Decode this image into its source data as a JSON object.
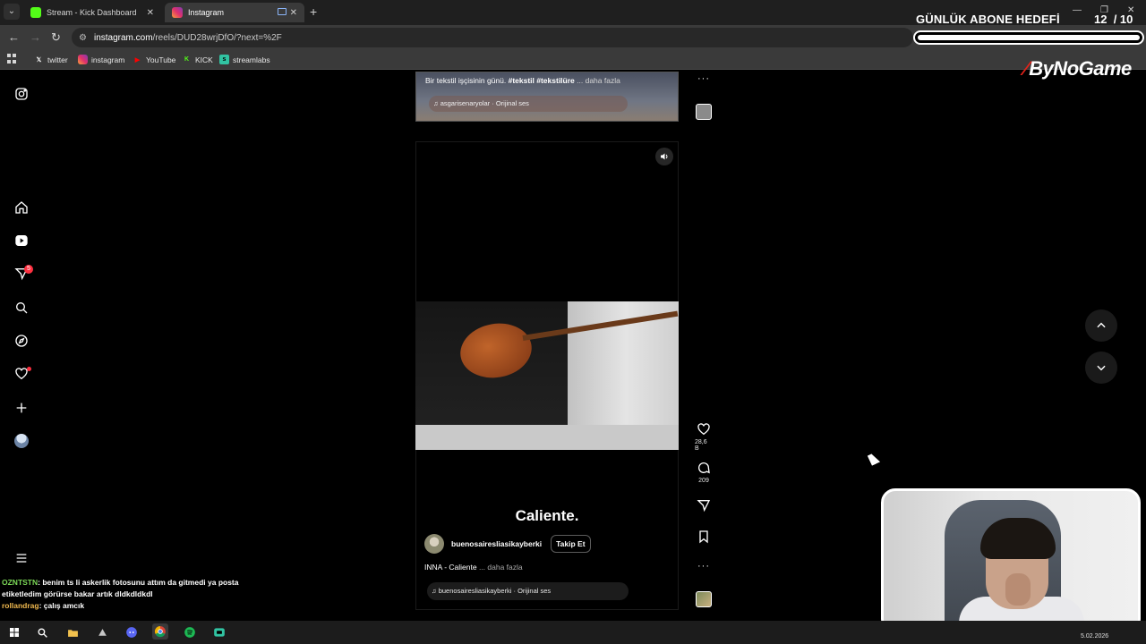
{
  "browser": {
    "tabs": [
      {
        "label": "Stream - Kick Dashboard",
        "favicon_color": "#53fc18"
      },
      {
        "label": "Instagram",
        "favicon_color": "#e1306c"
      }
    ],
    "url_host": "instagram.com",
    "url_path": "/reels/DUD28wrjDfO/?next=%2F",
    "bookmarks": [
      {
        "label": "twitter",
        "icon": "x-icon"
      },
      {
        "label": "instagram",
        "icon": "instagram-icon"
      },
      {
        "label": "YouTube",
        "icon": "youtube-icon"
      },
      {
        "label": "KICK",
        "icon": "kick-icon"
      },
      {
        "label": "streamlabs",
        "icon": "streamlabs-icon"
      }
    ]
  },
  "overlay": {
    "goal_title": "GÜNLÜK ABONE HEDEFİ",
    "goal_current": "12",
    "goal_total": "/ 10",
    "goal_progress": 1.0,
    "brand": "ByNoGame"
  },
  "chat": [
    {
      "user": "OZNTSTN",
      "message": ": benim ts li askerlik fotosunu attım da gitmedi ya posta etiketledim görürse bakar artık dldkdldkdl"
    },
    {
      "user": "rollandrag",
      "message": ": çalış amcık"
    }
  ],
  "prev_reel": {
    "caption_plain": "Bir tekstil işçisinin günü. ",
    "caption_tags": "#tekstil #tekstilüre",
    "caption_more": " ... daha fazla",
    "audio": "♫ asgarisenaryolar · Orijinal ses"
  },
  "reel": {
    "title": "Caliente.",
    "username": "buenosairesliasikayberki",
    "follow_label": "Takip Et",
    "song": "INNA - Caliente",
    "song_more": " ... daha fazla",
    "audio": "♫ buenosairesliasikayberki · Orijinal ses",
    "likes": "28,6 B",
    "comments": "209"
  },
  "sidebar": {
    "notification_count": "5"
  },
  "taskbar": {
    "date": "5.02.2026"
  },
  "colors": {
    "accent_red": "#ff3040",
    "kick_green": "#53fc18",
    "brand_red": "#e2231a"
  }
}
